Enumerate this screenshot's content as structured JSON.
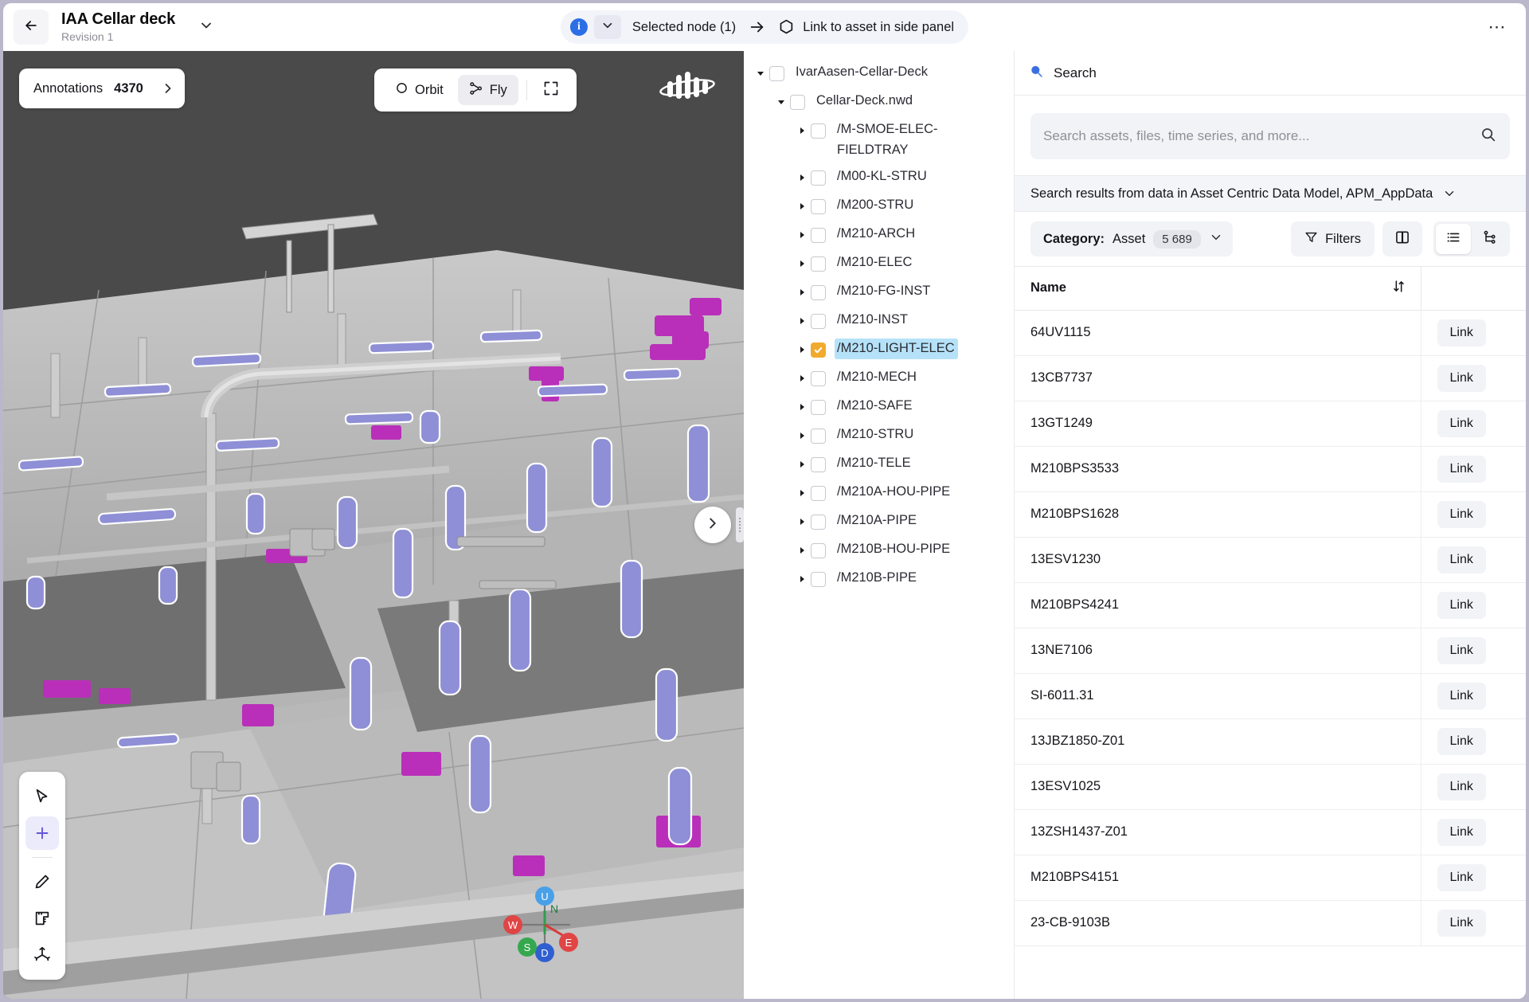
{
  "header": {
    "back_icon": "arrow-left-icon",
    "title": "IAA Cellar deck",
    "subtitle": "Revision 1",
    "caret_icon": "chevron-down-icon",
    "selected_node_label": "Selected node (1)",
    "arrow_icon": "arrow-right-icon",
    "link_asset_label": "Link to asset in side panel",
    "hex_icon": "hexagon-icon",
    "info_icon": "info-icon",
    "more_label": "⋯",
    "more_icon": "more-options-icon"
  },
  "viewer": {
    "annotations_label": "Annotations",
    "annotations_count": "4370",
    "annotations_chevron": "chevron-right-icon",
    "modes": [
      {
        "label": "Orbit",
        "icon": "orbit-icon",
        "active": false
      },
      {
        "label": "Fly",
        "icon": "fly-icon",
        "active": true
      }
    ],
    "expand_icon": "fullscreen-icon",
    "brand_icon": "cognite-logo-icon",
    "collapse_icon": "chevron-right-icon",
    "tools": [
      {
        "icon": "cursor-select-icon",
        "active": false
      },
      {
        "icon": "add-annotation-icon",
        "active": true
      },
      {
        "icon": "pen-icon",
        "active": false
      },
      {
        "icon": "ruler-icon",
        "active": false
      },
      {
        "icon": "axis-icon",
        "active": false
      }
    ],
    "compass": {
      "up": "U",
      "down": "D",
      "north": "N",
      "south": "S",
      "east": "E",
      "west": "W"
    }
  },
  "tree": {
    "nodes": [
      {
        "label": "IvarAasen-Cellar-Deck",
        "depth": 0,
        "expanded": true,
        "checked": false,
        "selected": false,
        "has_children": true
      },
      {
        "label": "Cellar-Deck.nwd",
        "depth": 1,
        "expanded": true,
        "checked": false,
        "selected": false,
        "has_children": true
      },
      {
        "label": "/M-SMOE-ELEC-FIELDTRAY",
        "depth": 2,
        "expanded": false,
        "checked": false,
        "selected": false,
        "has_children": true
      },
      {
        "label": "/M00-KL-STRU",
        "depth": 2,
        "expanded": false,
        "checked": false,
        "selected": false,
        "has_children": true
      },
      {
        "label": "/M200-STRU",
        "depth": 2,
        "expanded": false,
        "checked": false,
        "selected": false,
        "has_children": true
      },
      {
        "label": "/M210-ARCH",
        "depth": 2,
        "expanded": false,
        "checked": false,
        "selected": false,
        "has_children": true
      },
      {
        "label": "/M210-ELEC",
        "depth": 2,
        "expanded": false,
        "checked": false,
        "selected": false,
        "has_children": true
      },
      {
        "label": "/M210-FG-INST",
        "depth": 2,
        "expanded": false,
        "checked": false,
        "selected": false,
        "has_children": true
      },
      {
        "label": "/M210-INST",
        "depth": 2,
        "expanded": false,
        "checked": false,
        "selected": false,
        "has_children": true
      },
      {
        "label": "/M210-LIGHT-ELEC",
        "depth": 2,
        "expanded": false,
        "checked": true,
        "selected": true,
        "has_children": true
      },
      {
        "label": "/M210-MECH",
        "depth": 2,
        "expanded": false,
        "checked": false,
        "selected": false,
        "has_children": true
      },
      {
        "label": "/M210-SAFE",
        "depth": 2,
        "expanded": false,
        "checked": false,
        "selected": false,
        "has_children": true
      },
      {
        "label": "/M210-STRU",
        "depth": 2,
        "expanded": false,
        "checked": false,
        "selected": false,
        "has_children": true
      },
      {
        "label": "/M210-TELE",
        "depth": 2,
        "expanded": false,
        "checked": false,
        "selected": false,
        "has_children": true
      },
      {
        "label": "/M210A-HOU-PIPE",
        "depth": 2,
        "expanded": false,
        "checked": false,
        "selected": false,
        "has_children": true
      },
      {
        "label": "/M210A-PIPE",
        "depth": 2,
        "expanded": false,
        "checked": false,
        "selected": false,
        "has_children": true
      },
      {
        "label": "/M210B-HOU-PIPE",
        "depth": 2,
        "expanded": false,
        "checked": false,
        "selected": false,
        "has_children": true
      },
      {
        "label": "/M210B-PIPE",
        "depth": 2,
        "expanded": false,
        "checked": false,
        "selected": false,
        "has_children": true
      }
    ]
  },
  "side_panel": {
    "title": "Search",
    "title_icon": "search-icon",
    "search_placeholder": "Search assets, files, time series, and more...",
    "search_value": "",
    "search_submit_icon": "search-submit-icon",
    "source_label": "Search results from data in Asset Centric Data Model, APM_AppData",
    "source_chevron": "chevron-down-icon",
    "category_key": "Category:",
    "category_value": "Asset",
    "category_count": "5 689",
    "category_chevron": "chevron-down-icon",
    "filters_label": "Filters",
    "filters_icon": "filter-icon",
    "view_buttons": [
      {
        "icon": "split-view-icon",
        "selected": false
      },
      {
        "icon": "list-view-icon",
        "selected": true
      },
      {
        "icon": "hierarchy-view-icon",
        "selected": false
      }
    ],
    "table": {
      "columns": [
        "Name",
        ""
      ],
      "sort_icon": "sort-icon",
      "link_label": "Link",
      "rows": [
        {
          "name": "64UV1115"
        },
        {
          "name": "13CB7737"
        },
        {
          "name": "13GT1249"
        },
        {
          "name": "M210BPS3533"
        },
        {
          "name": "M210BPS1628"
        },
        {
          "name": "13ESV1230"
        },
        {
          "name": "M210BPS4241"
        },
        {
          "name": "13NE7106"
        },
        {
          "name": "SI-6011.31"
        },
        {
          "name": "13JBZ1850-Z01"
        },
        {
          "name": "13ESV1025"
        },
        {
          "name": "13ZSH1437-Z01"
        },
        {
          "name": "M210BPS4151"
        },
        {
          "name": "23-CB-9103B"
        }
      ]
    }
  },
  "colors": {
    "accent_blue": "#2c6ee6",
    "checkbox_amber": "#f0ab2e",
    "selection_blue": "#b5e2f8",
    "tool_active": "#6156d8",
    "page_bg": "#b9b7c9"
  }
}
